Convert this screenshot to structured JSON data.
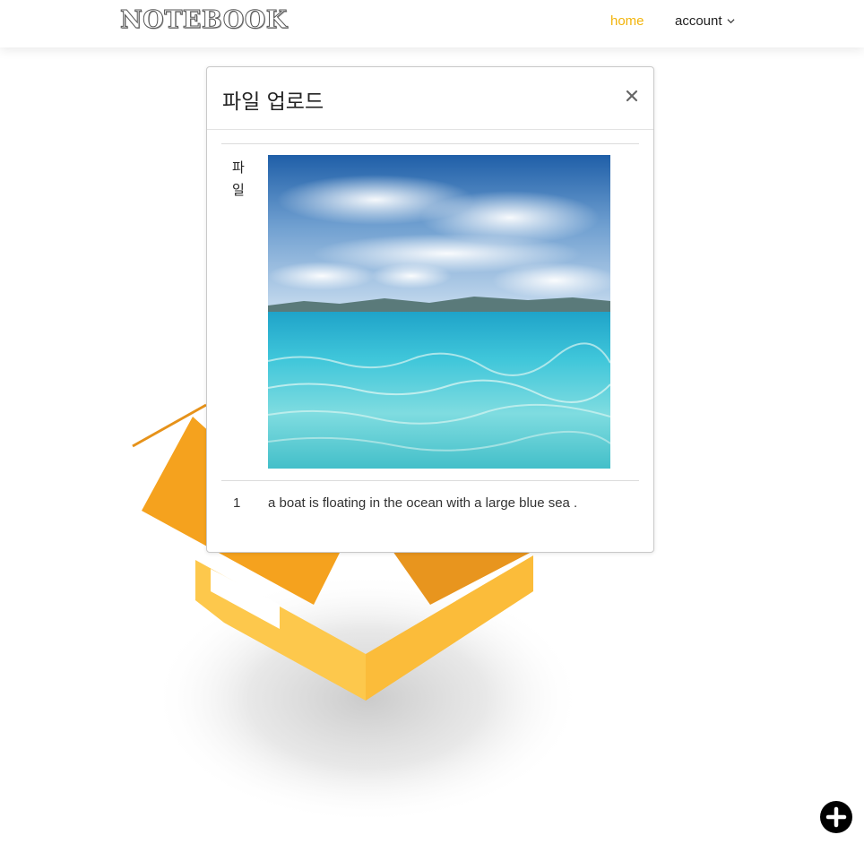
{
  "navbar": {
    "brand": "NOTEBOOK",
    "home_label": "home",
    "account_label": "account",
    "home_color": "#f2b40c"
  },
  "modal": {
    "title": "파일 업로드",
    "close_icon": "close-icon",
    "table": {
      "header_label": "파일",
      "rows": [
        {
          "index": "1",
          "caption": "a boat is floating in the ocean with a large blue sea ."
        }
      ]
    }
  },
  "icons": {
    "fab": "plus-icon",
    "account_dropdown": "chevron-down-icon"
  },
  "colors": {
    "accent": "#f2b40c",
    "box_orange": "#f5a21e",
    "box_yellow": "#fbbf3c"
  }
}
